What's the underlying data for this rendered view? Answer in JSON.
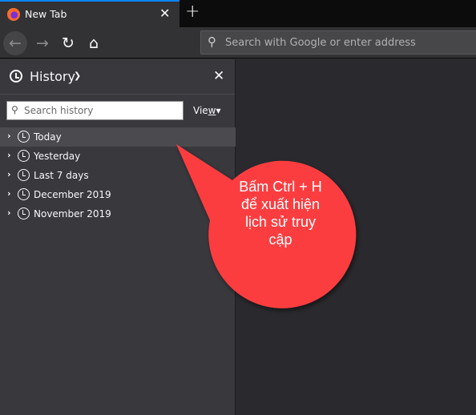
{
  "tab": {
    "title": "New Tab",
    "close": "✕",
    "new_tab": "+"
  },
  "toolbar": {
    "back": "←",
    "forward": "→",
    "reload": "↻",
    "home": "⌂",
    "url_placeholder": "Search with Google or enter address",
    "search_icon": "🔍"
  },
  "sidebar": {
    "title": "History",
    "chevron": "⌄",
    "close": "✕",
    "search_placeholder": "Search history",
    "view_label_pre": "Vie",
    "view_label_u": "w",
    "view_chevron": "▾",
    "items": [
      {
        "label": "Today",
        "selected": true
      },
      {
        "label": "Yesterday"
      },
      {
        "label": "Last 7 days"
      },
      {
        "label": "December 2019"
      },
      {
        "label": "November 2019"
      }
    ],
    "twisty": "›"
  },
  "callout": {
    "lines": [
      "Bấm Ctrl + H",
      "để xuất hiện",
      "lịch sử truy",
      "cập"
    ],
    "color": "#fc3e40"
  }
}
